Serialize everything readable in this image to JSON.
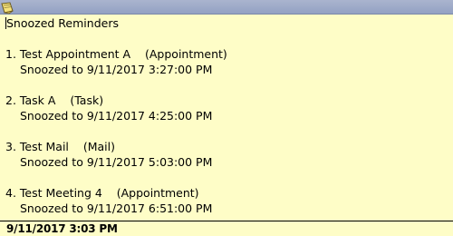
{
  "title": "Snoozed Reminders",
  "reminders": [
    {
      "number": "1.",
      "subject": "Test Appointment A",
      "type": "(Appointment)",
      "snoozed": "Snoozed to 9/11/2017 3:27:00 PM"
    },
    {
      "number": "2.",
      "subject": "Task A",
      "type": "(Task)",
      "snoozed": "Snoozed to 9/11/2017 4:25:00 PM"
    },
    {
      "number": "3.",
      "subject": "Test Mail",
      "type": "(Mail)",
      "snoozed": "Snoozed to 9/11/2017 5:03:00 PM"
    },
    {
      "number": "4.",
      "subject": "Test Meeting 4",
      "type": "(Appointment)",
      "snoozed": "Snoozed to 9/11/2017 6:51:00 PM"
    }
  ],
  "footer": {
    "timestamp": "9/11/2017 3:03 PM"
  },
  "colors": {
    "note_background": "#fefdc7",
    "titlebar": "#9aa7c8",
    "text": "#000000"
  },
  "icons": {
    "titlebar_icon": "note-icon"
  }
}
